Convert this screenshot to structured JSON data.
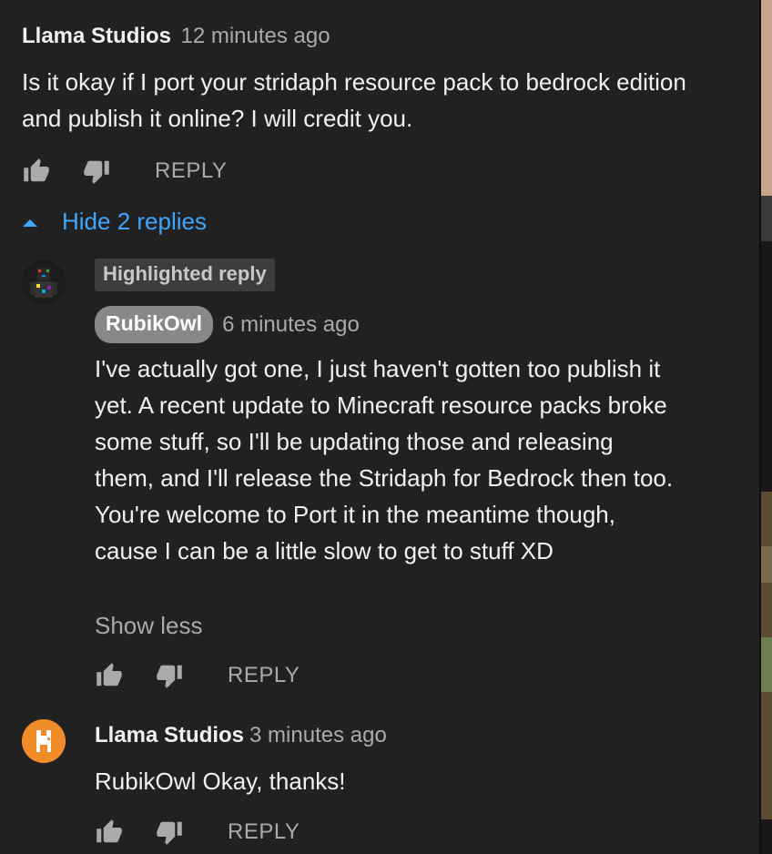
{
  "comment": {
    "author": "Llama Studios",
    "time": "12 minutes ago",
    "text": "Is it okay if I port your stridaph resource pack to bedrock edition and publish it online? I will credit you.",
    "reply_label": "REPLY",
    "toggle_label": "Hide 2 replies"
  },
  "replies": [
    {
      "badge": "Highlighted reply",
      "author": "RubikOwl",
      "time": "6 minutes ago",
      "text": "I've actually got one, I just haven't gotten too publish it yet. A recent update to Minecraft resource packs broke some stuff, so I'll be updating those and releasing them, and I'll release the Stridaph for Bedrock then too. You're welcome to Port it in the meantime though, cause I can be a little slow to get to stuff XD",
      "show_less": "Show less",
      "reply_label": "REPLY"
    },
    {
      "author": "Llama Studios",
      "time": "3 minutes ago",
      "text": "RubikOwl Okay, thanks!",
      "reply_label": "REPLY"
    }
  ],
  "colors": {
    "background": "#212121",
    "link_blue": "#3ea6ff",
    "muted": "#aaaaaa",
    "author_chip": "#888888",
    "avatar_orange": "#f28c28"
  },
  "icons": [
    "thumb-up-icon",
    "thumb-down-icon",
    "caret-up-icon"
  ]
}
